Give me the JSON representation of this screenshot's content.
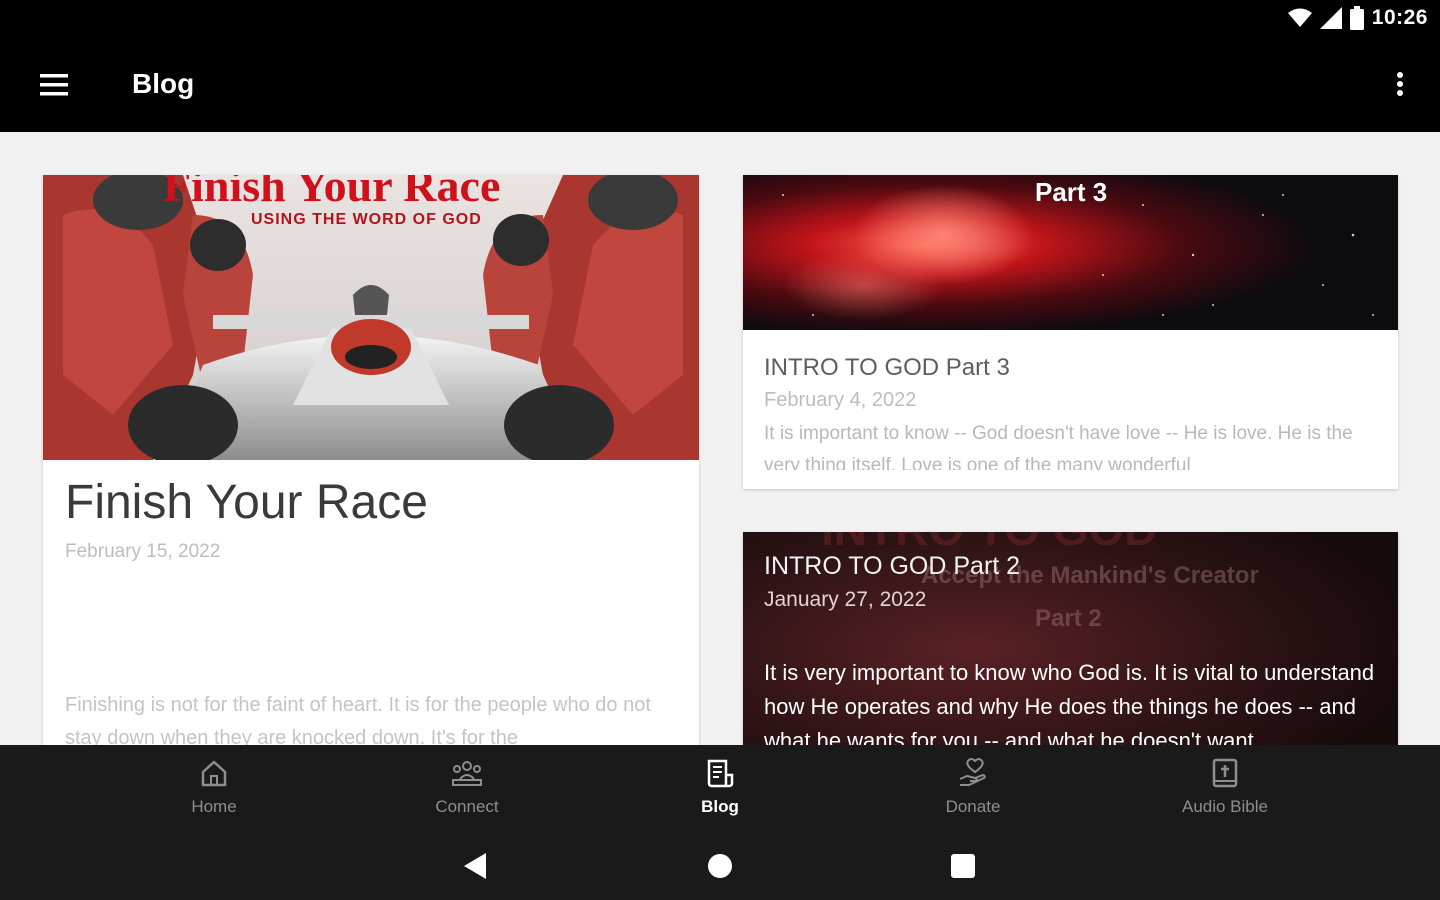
{
  "status_bar": {
    "time": "10:26"
  },
  "app_bar": {
    "title": "Blog"
  },
  "posts": [
    {
      "image_title": "Finish Your Race",
      "image_subtitle": "USING THE WORD OF GOD",
      "title": "Finish Your Race",
      "date": "February 15, 2022",
      "excerpt": "Finishing is not for the faint of heart. It is for the people who do not stay down when they are knocked down. It's for the"
    },
    {
      "image_label": "Part 3",
      "title": "INTRO TO GOD Part 3",
      "date": "February 4, 2022",
      "excerpt": "It is important to know -- God doesn't have love -- He is love. He is the very thing itself. Love is one of the many wonderful"
    },
    {
      "image_heading": "INTRO TO GOD",
      "image_subtitle": "Accept the Mankind's Creator",
      "image_label": "Part 2",
      "title": "INTRO TO GOD Part 2",
      "date": "January 27, 2022",
      "excerpt": "It is very important to know who God is. It is vital to understand how He operates and why He does the things he does -- and what he wants for you -- and what he doesn't want"
    }
  ],
  "bottom_nav": [
    {
      "label": "Home",
      "icon": "home-icon"
    },
    {
      "label": "Connect",
      "icon": "people-icon"
    },
    {
      "label": "Blog",
      "icon": "blog-icon",
      "active": true
    },
    {
      "label": "Donate",
      "icon": "donate-icon"
    },
    {
      "label": "Audio Bible",
      "icon": "bible-icon"
    }
  ],
  "colors": {
    "accent_red": "#d0101a",
    "nav_bg": "#1a1a1a",
    "content_bg": "#f1f1f1"
  }
}
